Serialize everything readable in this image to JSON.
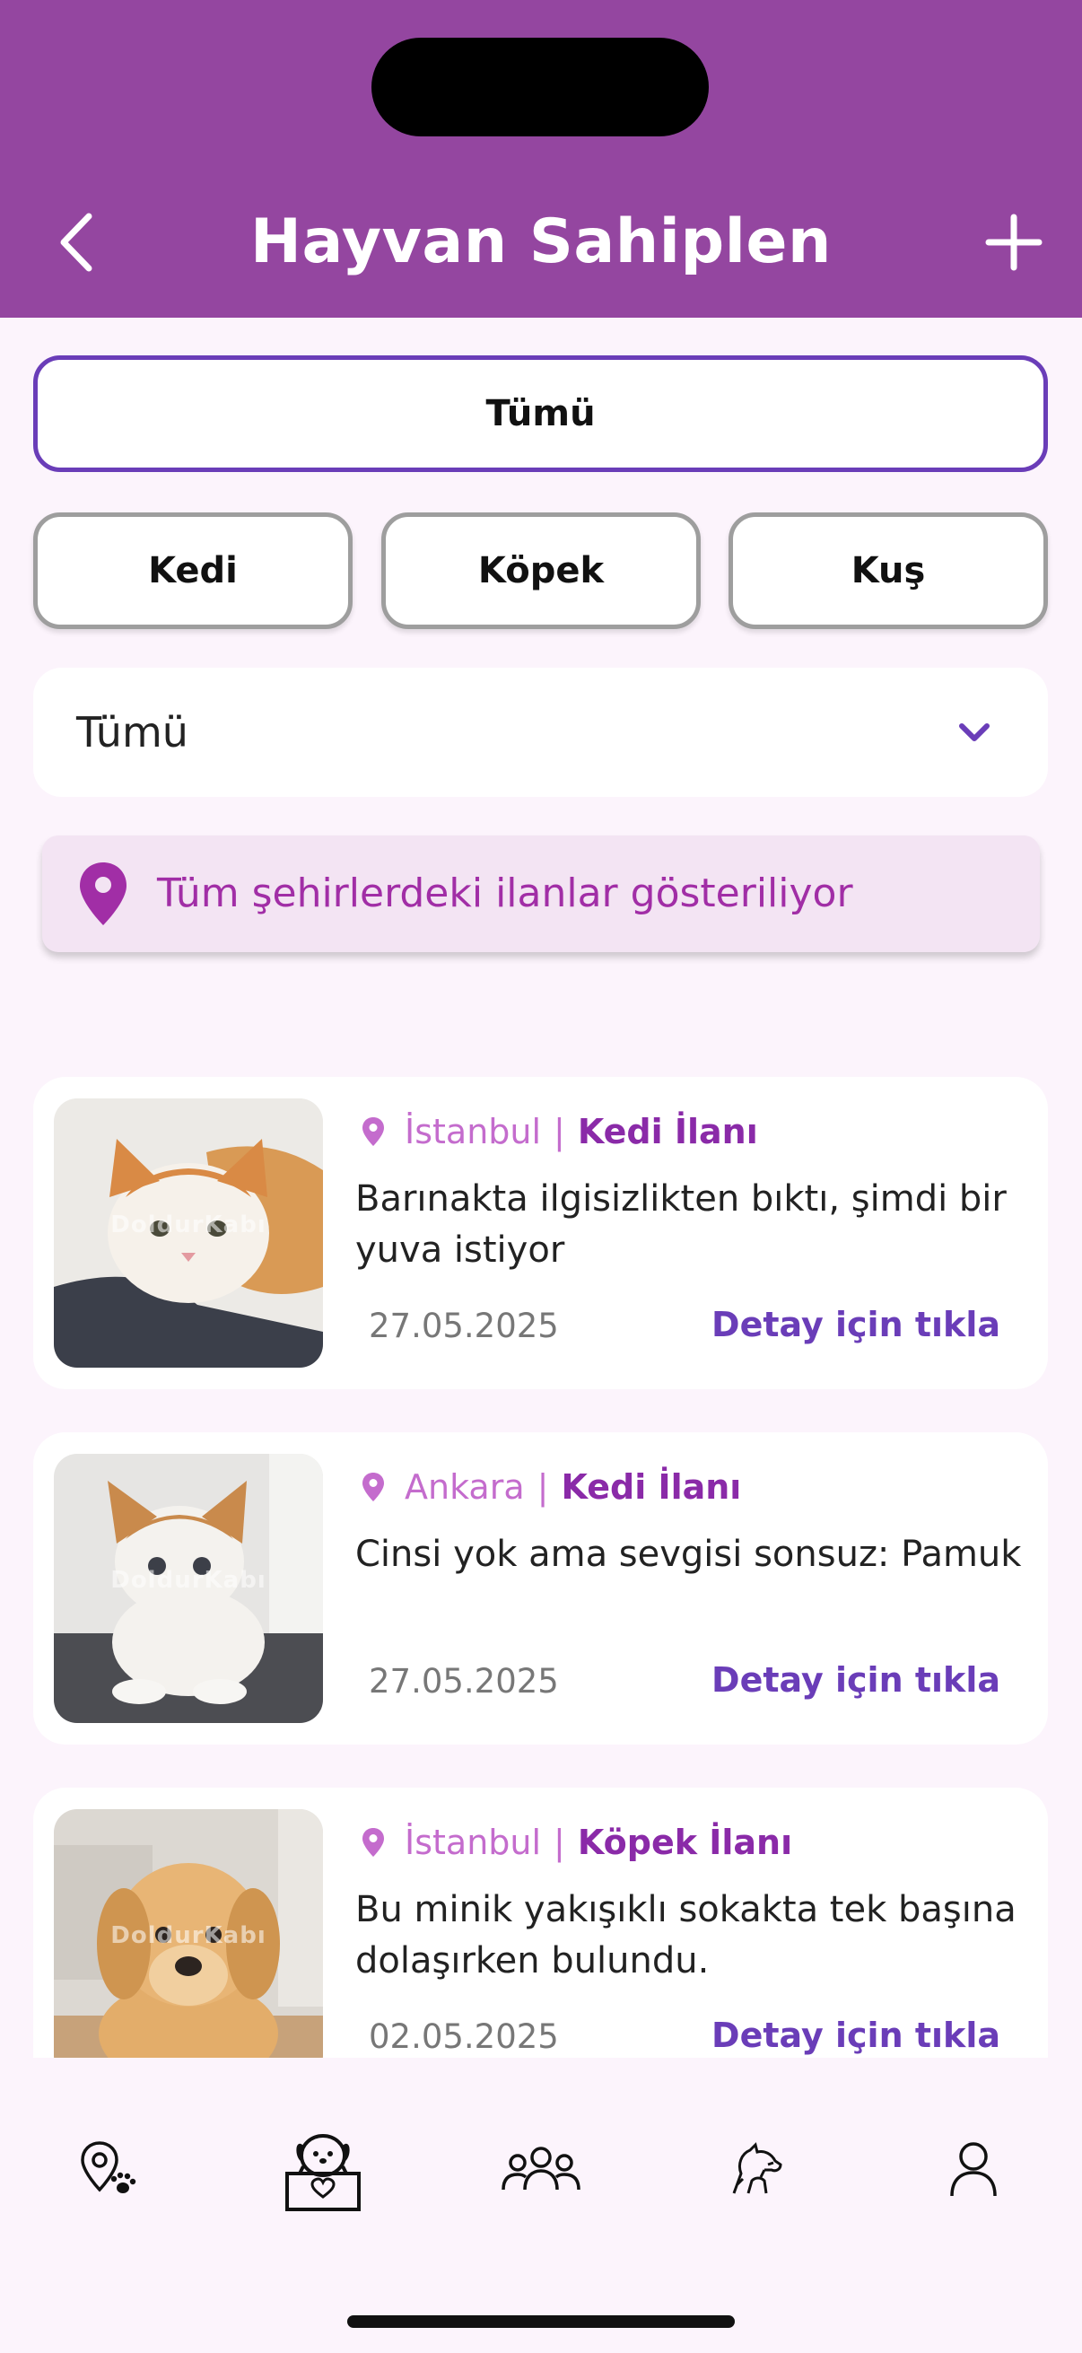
{
  "header": {
    "title": "Hayvan Sahiplen",
    "back_icon": "chevron-left-icon",
    "add_icon": "plus-icon",
    "background": "#9446a0"
  },
  "filters": {
    "all_label": "Tümü",
    "types": [
      {
        "label": "Kedi"
      },
      {
        "label": "Köpek"
      },
      {
        "label": "Kuş"
      }
    ],
    "selected": "Tümü"
  },
  "city_select": {
    "value": "Tümü",
    "icon": "chevron-down-icon"
  },
  "banner": {
    "icon": "location-pin-icon",
    "text": "Tüm şehirlerdeki ilanlar gösteriliyor"
  },
  "listings": [
    {
      "city": "İstanbul",
      "separator": "|",
      "kind": "Kedi İlanı",
      "description": "Barınakta ilgisizlikten bıktı, şimdi bir yuva istiyor",
      "date": "27.05.2025",
      "link": "Detay için tıkla",
      "watermark": "DoldurKabı"
    },
    {
      "city": "Ankara",
      "separator": "|",
      "kind": "Kedi İlanı",
      "description": "Cinsi yok ama sevgisi sonsuz: Pamuk",
      "date": "27.05.2025",
      "link": "Detay için tıkla",
      "watermark": "DoldurKabı"
    },
    {
      "city": "İstanbul",
      "separator": "|",
      "kind": "Köpek İlanı",
      "description": "Bu minik yakışıklı sokakta tek başına dolaşırken bulundu.",
      "date": "02.05.2025",
      "link": "Detay için tıkla",
      "watermark": "DoldurKabı"
    }
  ],
  "bottom_nav": {
    "items": [
      {
        "icon": "map-paw-icon"
      },
      {
        "icon": "adoption-box-icon",
        "active": true
      },
      {
        "icon": "community-icon"
      },
      {
        "icon": "pets-icon"
      },
      {
        "icon": "profile-icon"
      }
    ]
  },
  "colors": {
    "accent_purple": "#6a3db8",
    "magenta": "#a12ea6",
    "page_background": "#fcf4fc"
  }
}
